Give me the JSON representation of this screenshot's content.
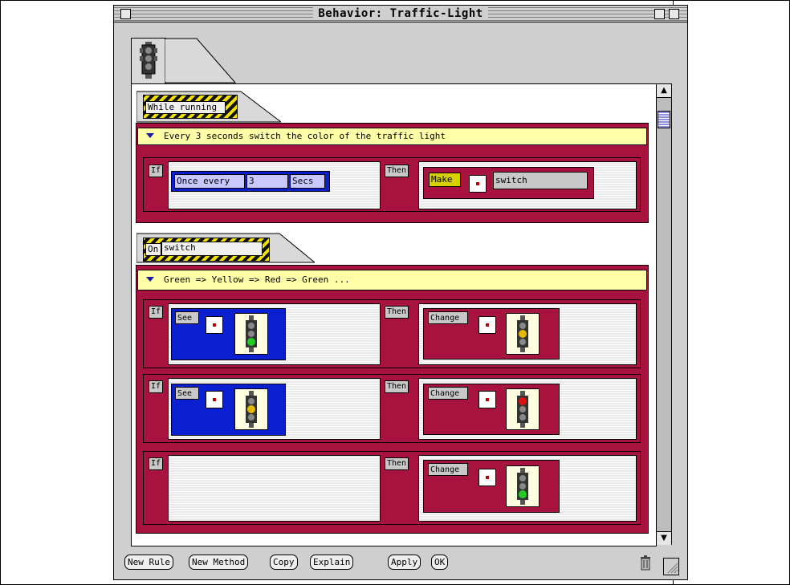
{
  "window": {
    "title": "Behavior: Traffic-Light"
  },
  "section1": {
    "tab_label": "While running",
    "rule": {
      "comment": "Every 3 seconds switch the color of the traffic light",
      "if_label": "If",
      "then_label": "Then",
      "condition": {
        "prefix": "Once every",
        "value": "3",
        "unit": "Secs"
      },
      "action": {
        "verb": "Make",
        "argument": "switch"
      }
    }
  },
  "section2": {
    "tab_prefix": "On",
    "tab_value": "switch",
    "comment": "Green => Yellow => Red => Green ...",
    "rules": [
      {
        "if_label": "If",
        "then_label": "Then",
        "condition_verb": "See",
        "condition_light": "green",
        "action_verb": "Change",
        "action_light": "yellow"
      },
      {
        "if_label": "If",
        "then_label": "Then",
        "condition_verb": "See",
        "condition_light": "yellow",
        "action_verb": "Change",
        "action_light": "red"
      },
      {
        "if_label": "If",
        "then_label": "Then",
        "condition_verb": "",
        "condition_light": "",
        "action_verb": "Change",
        "action_light": "green"
      }
    ]
  },
  "buttons": {
    "new_rule": "New Rule",
    "new_method": "New Method",
    "copy": "Copy",
    "explain": "Explain",
    "apply": "Apply",
    "ok": "OK"
  },
  "icons": {
    "trash": "trash-icon",
    "traffic_light": "traffic-light-icon",
    "lamp_colors": {
      "green": "#22cc22",
      "yellow": "#e6b800",
      "red": "#dd1111"
    }
  }
}
